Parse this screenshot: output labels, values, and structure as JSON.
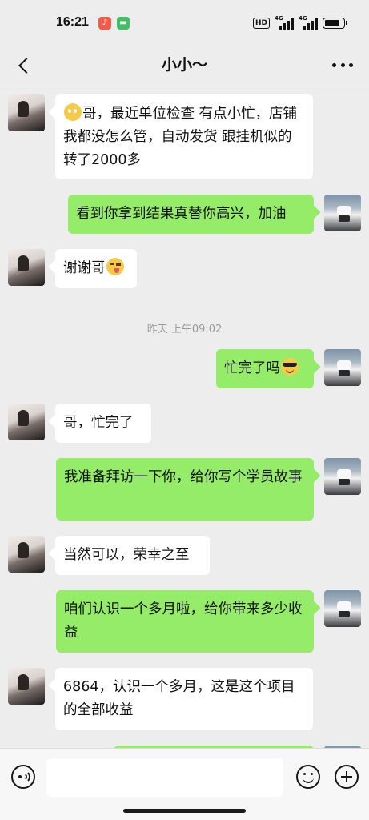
{
  "status_bar": {
    "time": "16:21",
    "hd_label": "HD",
    "signal1_label": "4G",
    "signal2_label": "4G",
    "notification_icons": [
      "music-app-icon",
      "chat-app-icon"
    ]
  },
  "header": {
    "title": "小小～",
    "back_icon": "chevron-left-icon",
    "more_icon": "ellipsis-icon"
  },
  "messages": [
    {
      "side": "in",
      "emoji_before": "flushed-emoji",
      "text": "哥，最近单位检查 有点小忙，店铺我都没怎么管，自动发货 跟挂机似的 转了2000多"
    },
    {
      "side": "out",
      "text": "看到你拿到结果真替你高兴，加油"
    },
    {
      "side": "in",
      "text": "谢谢哥",
      "emoji_after": "wink-emoji"
    },
    {
      "side": "out",
      "text": "忙完了吗",
      "emoji_after": "sunglasses-emoji"
    },
    {
      "side": "in",
      "text": "哥，忙完了"
    },
    {
      "side": "out",
      "text": "我准备拜访一下你，给你写个学员故事"
    },
    {
      "side": "in",
      "text": "当然可以，荣幸之至"
    },
    {
      "side": "out",
      "text": "咱们认识一个多月啦，给你带来多少收益"
    },
    {
      "side": "in",
      "text": "6864，认识一个多月，这是这个项目的全部收益"
    }
  ],
  "timestamp": "昨天 上午09:02",
  "input_bar": {
    "placeholder": "",
    "voice_icon": "voice-icon",
    "emoji_icon": "emoji-icon",
    "plus_icon": "plus-icon"
  },
  "colors": {
    "background": "#ededed",
    "bubble_out": "#95ec69",
    "bubble_in": "#ffffff"
  }
}
